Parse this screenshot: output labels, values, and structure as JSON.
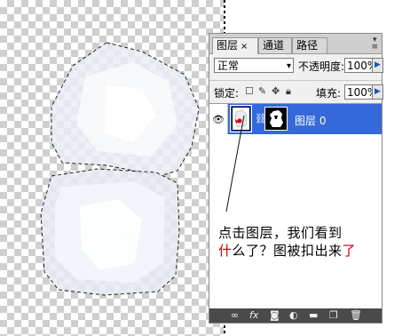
{
  "panel": {
    "tabs": [
      {
        "label": "图层",
        "close": "×",
        "active": true
      },
      {
        "label": "通道",
        "active": false
      },
      {
        "label": "路径",
        "active": false
      }
    ],
    "menu_icon": "panel-menu-icon",
    "blend_mode": "正常",
    "opacity_label": "不透明度:",
    "opacity_value": "100%",
    "lock_label": "锁定:",
    "fill_label": "填充:",
    "fill_value": "100%",
    "layers": [
      {
        "name": "图层 0",
        "visible": true,
        "selected": true
      }
    ],
    "bottom_icons": [
      "link-icon",
      "fx-icon",
      "mask-icon",
      "adjustment-icon",
      "group-folder-icon",
      "new-layer-icon",
      "trash-icon"
    ],
    "selected_color": "#3569d9"
  },
  "annotation": {
    "line1": "点击图层，我们看到",
    "line2_red1": "什",
    "line2_mid": "么了？图被扣出来",
    "line2_red2": "了"
  }
}
